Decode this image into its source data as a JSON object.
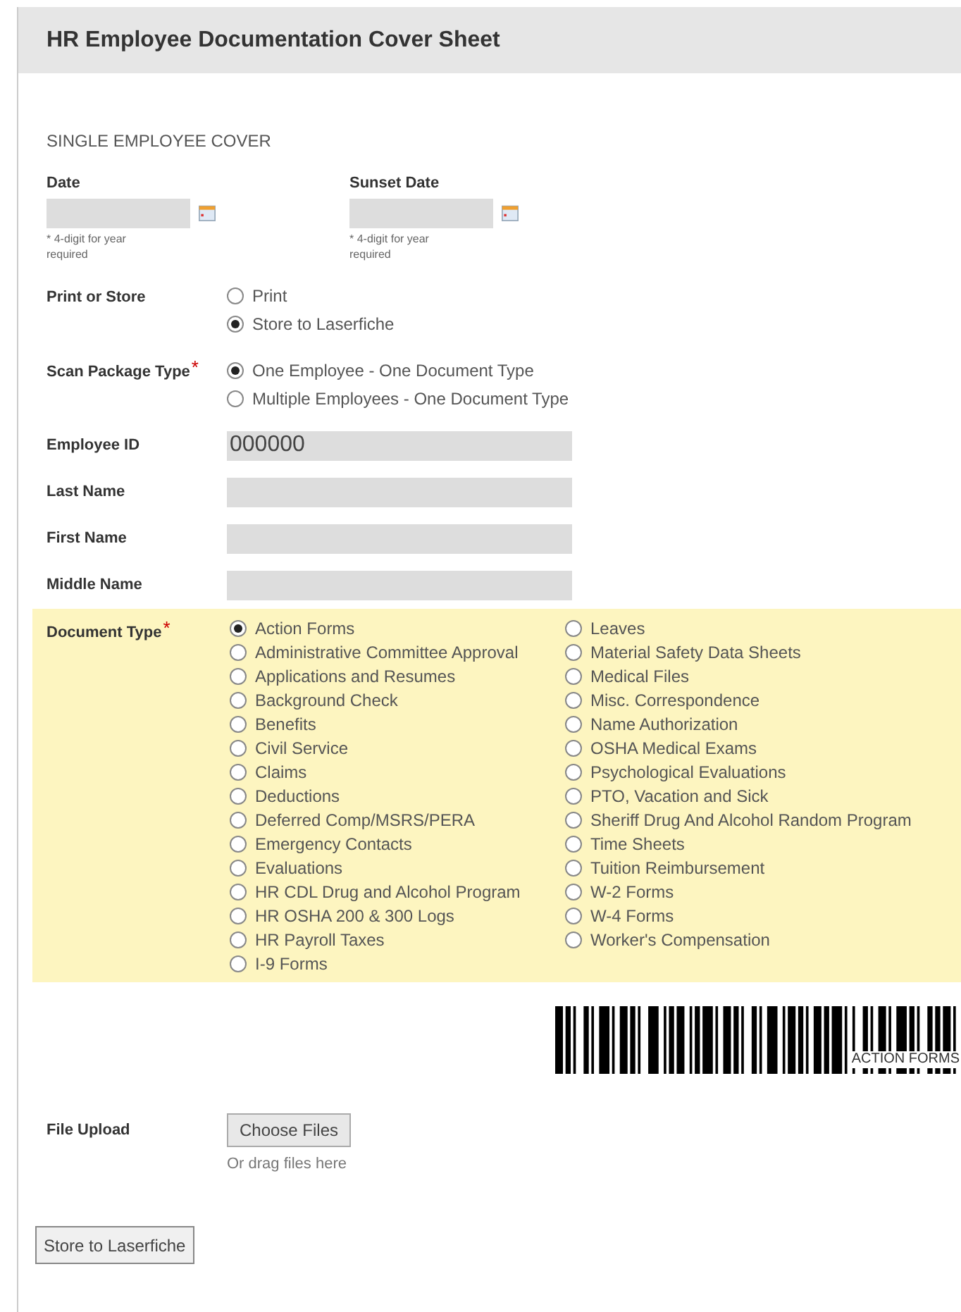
{
  "header": {
    "title": "HR Employee Documentation Cover Sheet"
  },
  "section_title": "SINGLE EMPLOYEE COVER",
  "date_fields": [
    {
      "label": "Date",
      "hint": "* 4-digit for year required"
    },
    {
      "label": "Sunset Date",
      "hint": "* 4-digit for year required"
    }
  ],
  "radio_groups": [
    {
      "label": "Print or Store",
      "options": [
        {
          "label": "Print",
          "selected": false
        },
        {
          "label": "Store to Laserfiche",
          "selected": true
        }
      ]
    },
    {
      "label": "Scan Package Type",
      "required_mark": "*",
      "options": [
        {
          "label": "One Employee - One Document Type",
          "selected": true
        },
        {
          "label": "Multiple Employees - One Document Type",
          "selected": false
        }
      ]
    }
  ],
  "text_fields": [
    {
      "label": "Employee ID",
      "value": "000000"
    },
    {
      "label": "Last Name"
    },
    {
      "label": "First Name"
    },
    {
      "label": "Middle Name"
    }
  ],
  "document_type": {
    "label": "Document Type",
    "required_mark": "*",
    "columns": [
      [
        {
          "label": "Action Forms",
          "selected": true
        },
        {
          "label": "Administrative Committee Approval",
          "selected": false
        },
        {
          "label": "Applications and Resumes",
          "selected": false
        },
        {
          "label": "Background Check",
          "selected": false
        },
        {
          "label": "Benefits",
          "selected": false
        },
        {
          "label": "Civil Service",
          "selected": false
        },
        {
          "label": "Claims",
          "selected": false
        },
        {
          "label": "Deductions",
          "selected": false
        },
        {
          "label": "Deferred Comp/MSRS/PERA",
          "selected": false
        },
        {
          "label": "Emergency Contacts",
          "selected": false
        },
        {
          "label": "Evaluations",
          "selected": false
        },
        {
          "label": "HR CDL Drug and Alcohol Program",
          "selected": false
        },
        {
          "label": "HR OSHA 200 & 300 Logs",
          "selected": false
        },
        {
          "label": "HR Payroll Taxes",
          "selected": false
        },
        {
          "label": "I-9 Forms",
          "selected": false
        }
      ],
      [
        {
          "label": "Leaves",
          "selected": false
        },
        {
          "label": "Material Safety Data Sheets",
          "selected": false
        },
        {
          "label": "Medical Files",
          "selected": false
        },
        {
          "label": "Misc. Correspondence",
          "selected": false
        },
        {
          "label": "Name Authorization",
          "selected": false
        },
        {
          "label": "OSHA Medical Exams",
          "selected": false
        },
        {
          "label": "Psychological Evaluations",
          "selected": false
        },
        {
          "label": "PTO, Vacation and Sick",
          "selected": false
        },
        {
          "label": "Sheriff Drug And Alcohol Random Program",
          "selected": false
        },
        {
          "label": "Time Sheets",
          "selected": false
        },
        {
          "label": "Tuition Reimbursement",
          "selected": false
        },
        {
          "label": "W-2 Forms",
          "selected": false
        },
        {
          "label": "W-4 Forms",
          "selected": false
        },
        {
          "label": "Worker's Compensation",
          "selected": false
        }
      ]
    ]
  },
  "barcode": {
    "caption": "ACTION FORMS"
  },
  "file_upload": {
    "label": "File Upload",
    "button": "Choose Files",
    "hint": "Or drag files here"
  },
  "submit_button": "Store to Laserfiche"
}
